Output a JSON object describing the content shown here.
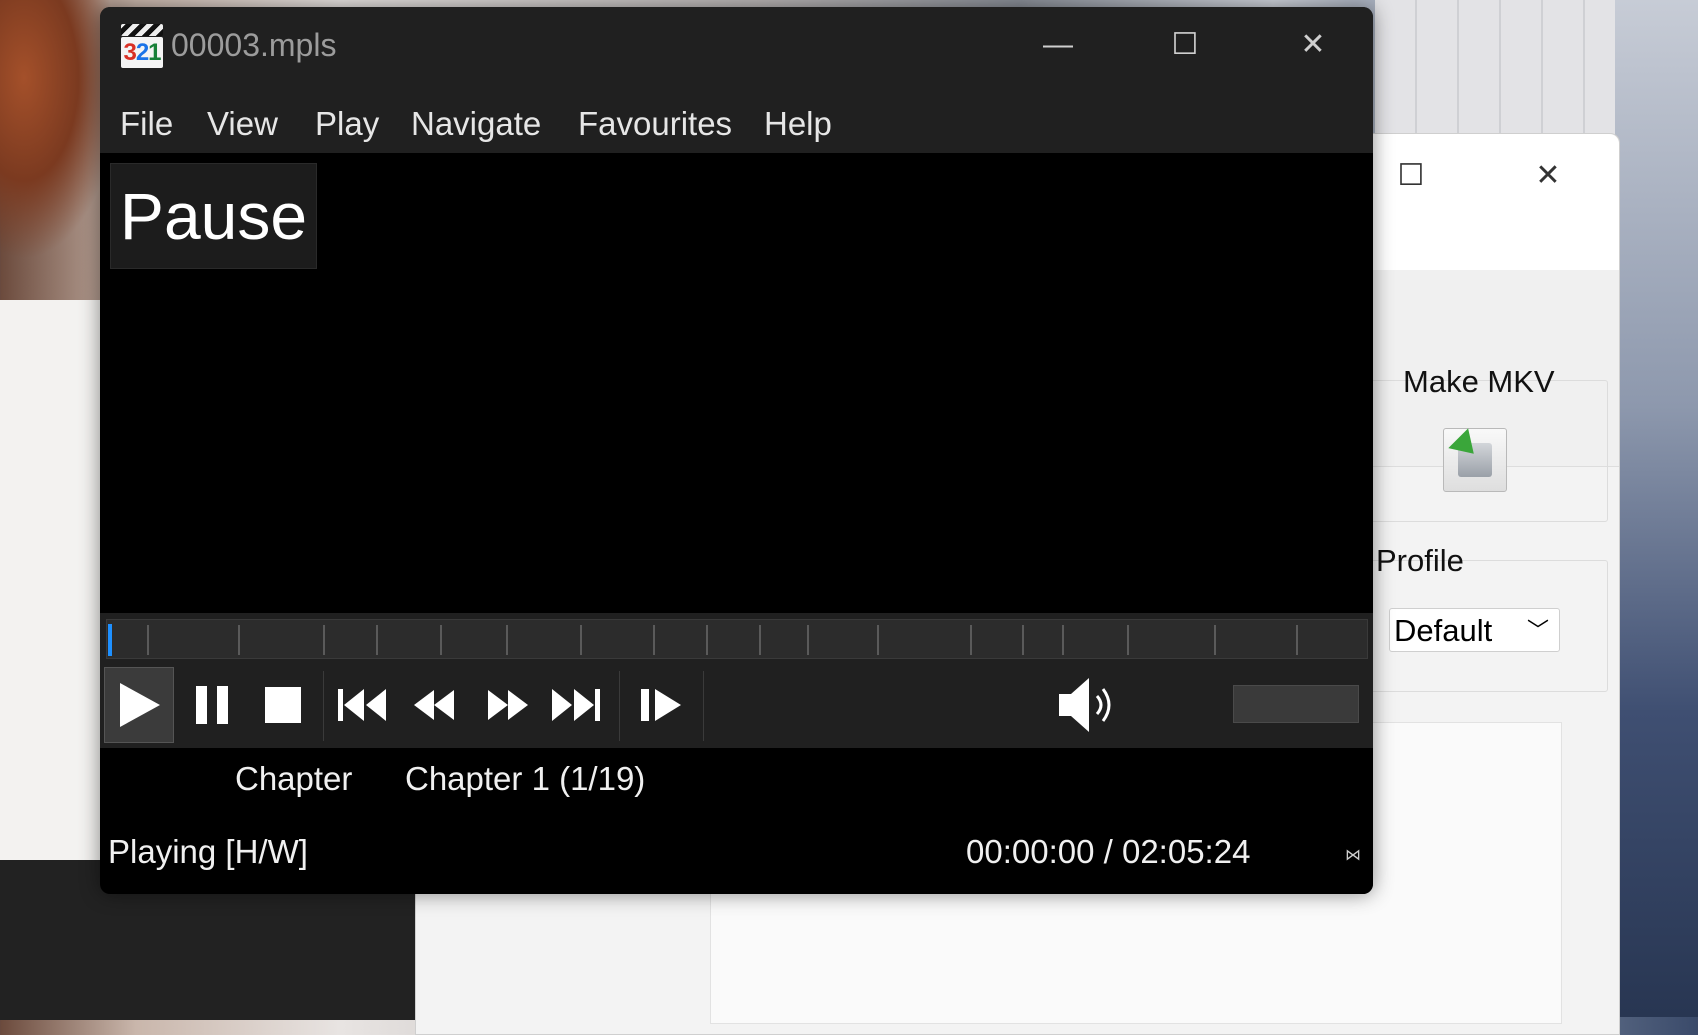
{
  "player": {
    "title": "00003.mpls",
    "menu": [
      "File",
      "View",
      "Play",
      "Navigate",
      "Favourites",
      "Help"
    ],
    "osd_text": "Pause",
    "info_label": "Chapter",
    "info_value": "Chapter 1 (1/19)",
    "status": "Playing [H/W]",
    "time": "00:00:00 / 02:05:24",
    "seek_progress": 0.0,
    "chapter_count": 19,
    "accent_color": "#1e90ff"
  },
  "background_window": {
    "make_mkv_label": "Make MKV",
    "profile_label": "Profile",
    "profile_value": "Default"
  }
}
